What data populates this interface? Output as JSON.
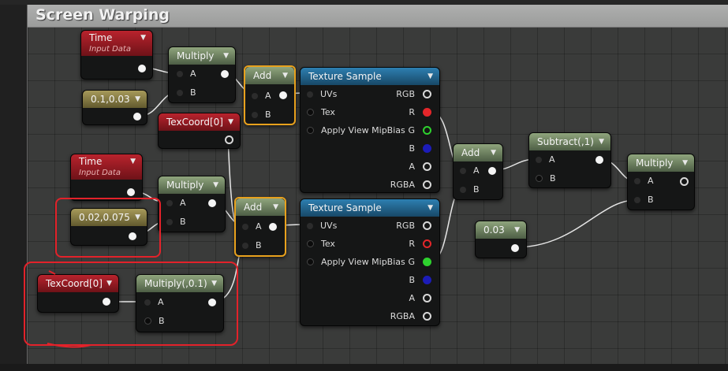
{
  "comment": {
    "title": "Screen Warping"
  },
  "nodes": {
    "time1": {
      "title": "Time",
      "subtitle": "Input Data"
    },
    "const1": {
      "title": "0.1,0.03"
    },
    "mul1": {
      "title": "Multiply",
      "pin_a": "A",
      "pin_b": "B"
    },
    "texcoord1": {
      "title": "TexCoord[0]"
    },
    "add1": {
      "title": "Add",
      "pin_a": "A",
      "pin_b": "B"
    },
    "tex1": {
      "title": "Texture Sample",
      "inputs": [
        "UVs",
        "Tex",
        "Apply View MipBias"
      ],
      "outputs": [
        "RGB",
        "R",
        "G",
        "B",
        "A",
        "RGBA"
      ]
    },
    "time2": {
      "title": "Time",
      "subtitle": "Input Data"
    },
    "const2": {
      "title": "0.02,0.075"
    },
    "mul2": {
      "title": "Multiply",
      "pin_a": "A",
      "pin_b": "B"
    },
    "add2": {
      "title": "Add",
      "pin_a": "A",
      "pin_b": "B"
    },
    "tex2": {
      "title": "Texture Sample",
      "inputs": [
        "UVs",
        "Tex",
        "Apply View MipBias"
      ],
      "outputs": [
        "RGB",
        "R",
        "G",
        "B",
        "A",
        "RGBA"
      ]
    },
    "texcoord2": {
      "title": "TexCoord[0]"
    },
    "mul3": {
      "title": "Multiply(,0.1)",
      "pin_a": "A",
      "pin_b": "B"
    },
    "add3": {
      "title": "Add",
      "pin_a": "A",
      "pin_b": "B"
    },
    "sub1": {
      "title": "Subtract(,1)",
      "pin_a": "A",
      "pin_b": "B"
    },
    "const3": {
      "title": "0.03"
    },
    "mul4": {
      "title": "Multiply",
      "pin_a": "A",
      "pin_b": "B"
    }
  },
  "colors": {
    "selection": "#e8a11d",
    "annotation": "#e3222a",
    "pin_red": "#e4262a",
    "pin_green": "#2ed12e",
    "pin_blue": "#1c1cb8"
  }
}
